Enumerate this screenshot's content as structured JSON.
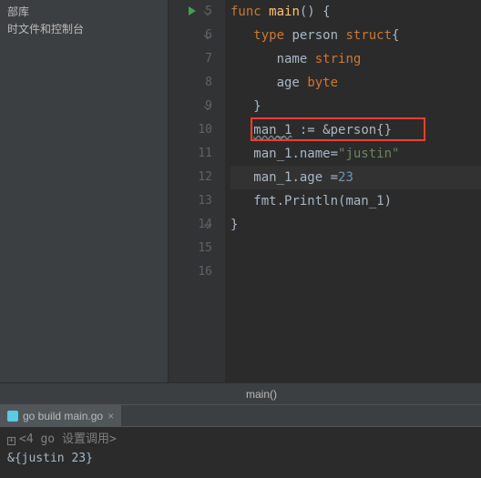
{
  "sidebar": {
    "item1": "部库",
    "item2": "时文件和控制台"
  },
  "code": {
    "lines": [
      {
        "num": "5",
        "tokens": [
          {
            "t": "kw",
            "v": "func"
          },
          {
            "t": "sp",
            "v": " "
          },
          {
            "t": "func",
            "v": "main"
          },
          {
            "t": "ident",
            "v": "() {"
          }
        ]
      },
      {
        "num": "6",
        "tokens": [
          {
            "t": "sp",
            "v": "   "
          },
          {
            "t": "kw",
            "v": "type"
          },
          {
            "t": "sp",
            "v": " "
          },
          {
            "t": "ident",
            "v": "person"
          },
          {
            "t": "sp",
            "v": " "
          },
          {
            "t": "kw",
            "v": "struct"
          },
          {
            "t": "ident",
            "v": "{"
          }
        ]
      },
      {
        "num": "7",
        "tokens": [
          {
            "t": "sp",
            "v": "      "
          },
          {
            "t": "ident",
            "v": "name"
          },
          {
            "t": "sp",
            "v": " "
          },
          {
            "t": "kw",
            "v": "string"
          }
        ]
      },
      {
        "num": "8",
        "tokens": [
          {
            "t": "sp",
            "v": "      "
          },
          {
            "t": "ident",
            "v": "age"
          },
          {
            "t": "sp",
            "v": " "
          },
          {
            "t": "kw",
            "v": "byte"
          }
        ]
      },
      {
        "num": "9",
        "tokens": [
          {
            "t": "sp",
            "v": "   "
          },
          {
            "t": "ident",
            "v": "}"
          }
        ]
      },
      {
        "num": "10",
        "tokens": [
          {
            "t": "sp",
            "v": "   "
          },
          {
            "t": "underline",
            "v": "man_1"
          },
          {
            "t": "ident",
            "v": " := "
          },
          {
            "t": "amp",
            "v": "&"
          },
          {
            "t": "ident",
            "v": "person{}"
          }
        ]
      },
      {
        "num": "11",
        "tokens": [
          {
            "t": "sp",
            "v": "   "
          },
          {
            "t": "ident",
            "v": "man_1.name="
          },
          {
            "t": "str",
            "v": "\"justin\""
          }
        ]
      },
      {
        "num": "12",
        "tokens": [
          {
            "t": "sp",
            "v": "   "
          },
          {
            "t": "ident",
            "v": "man_1.age ="
          },
          {
            "t": "num",
            "v": "23"
          }
        ]
      },
      {
        "num": "13",
        "tokens": [
          {
            "t": "sp",
            "v": "   "
          },
          {
            "t": "ident",
            "v": "fmt.Println(man_1)"
          }
        ]
      },
      {
        "num": "14",
        "tokens": [
          {
            "t": "ident",
            "v": "}"
          }
        ]
      },
      {
        "num": "15",
        "tokens": []
      },
      {
        "num": "16",
        "tokens": []
      }
    ],
    "highlightLine": 12,
    "redBoxLine": 10
  },
  "breadcrumb": {
    "text": "main()"
  },
  "tab": {
    "label": "go build main.go",
    "close": "×"
  },
  "console": {
    "meta_prefix": "<4 go 设置调用>",
    "output": "&{justin 23}"
  }
}
